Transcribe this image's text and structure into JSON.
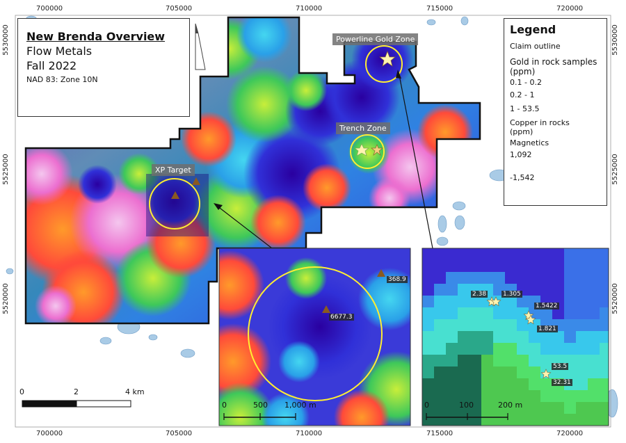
{
  "title": {
    "main": "New Brenda Overview",
    "company": "Flow Metals",
    "season": "Fall 2022",
    "datum": "NAD 83: Zone 10N"
  },
  "coordinates": {
    "top_x": [
      "700000",
      "705000",
      "710000",
      "715000",
      "720000"
    ],
    "bottom_x": [
      "700000",
      "705000",
      "710000",
      "715000",
      "720000"
    ],
    "left_y": [
      "5530000",
      "5525000",
      "5520000"
    ],
    "right_y": [
      "5530000",
      "5525000",
      "5520000"
    ]
  },
  "zones": {
    "powerline": "Powerline Gold Zone",
    "trench": "Trench Zone",
    "xp": "XP Target"
  },
  "legend": {
    "title": "Legend",
    "claim_outline": "Claim outline",
    "gold_header": "Gold in rock samples (ppm)",
    "gold_1": "0.1 - 0.2",
    "gold_2": "0.2 - 1",
    "gold_3": "1 - 53.5",
    "copper_header": "Copper in rocks (ppm)",
    "magnetics_header": "Magnetics",
    "mag_high": "1,092",
    "mag_low": "-1,542"
  },
  "scale_bar": {
    "labels": [
      "0",
      "2",
      "4 km"
    ]
  },
  "inset_xp": {
    "samples": [
      "368.9",
      "6677.3"
    ],
    "scale_labels": [
      "0",
      "500",
      "1,000 m"
    ]
  },
  "inset_powerline": {
    "samples": [
      "2.38",
      "1.305",
      "1.5422",
      "1.821",
      "53.5",
      "32.31"
    ],
    "scale_labels": [
      "0",
      "100",
      "200 m"
    ]
  },
  "colors": {
    "magnetics_high": "#f2c4f0",
    "magnetics_low": "#2a007a",
    "zone_circle": "#ffee33",
    "claim_outline": "#111111",
    "lake": "#a9cbe6"
  },
  "icons": [
    "north-arrow-icon",
    "star-icon",
    "triangle-icon",
    "dot-icon"
  ]
}
